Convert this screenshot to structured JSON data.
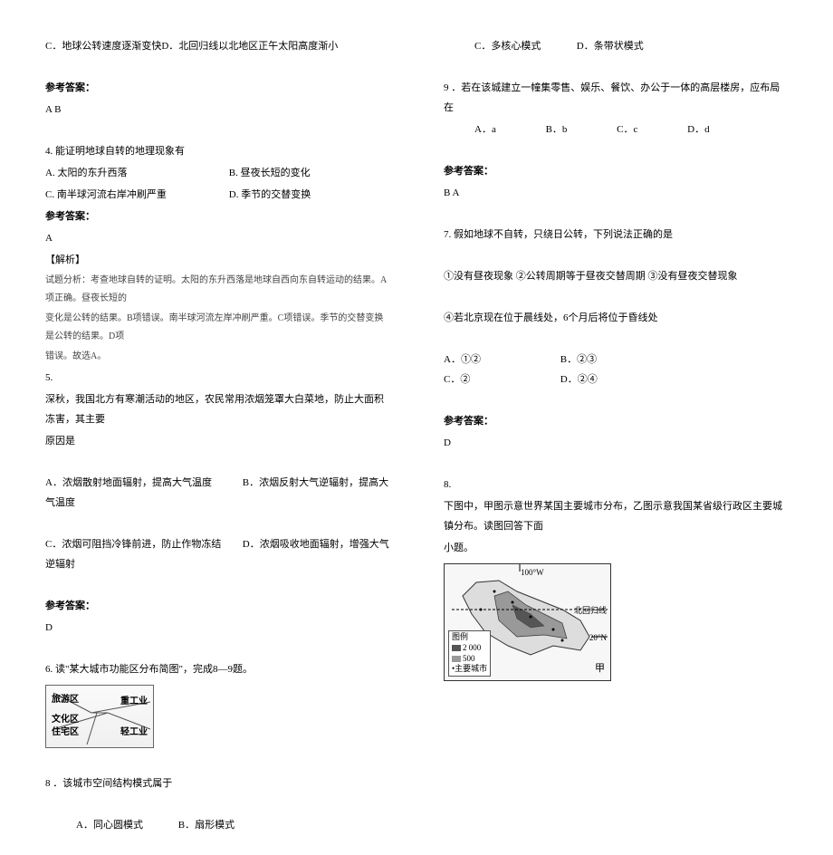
{
  "left": {
    "q3opt": "C．地球公转速度逐渐变快D．北回归线以北地区正午太阳高度渐小",
    "ansLabel1": "参考答案：",
    "ans1": "A  B",
    "q4": "4. 能证明地球自转的地理现象有",
    "q4a": "A. 太阳的东升西落",
    "q4b": "B. 昼夜长短的变化",
    "q4c": "C. 南半球河流右岸冲刷严重",
    "q4d": "D. 季节的交替变换",
    "ansLabel2": "参考答案：",
    "ans2": "A",
    "explLabel": "【解析】",
    "expl1": "试题分析：考查地球自转的证明。太阳的东升西落是地球自西向东自转运动的结果。A项正确。昼夜长短的",
    "expl2": "变化是公转的结果。B项错误。南半球河流左岸冲刷严重。C项错误。季节的交替变换是公转的结果。D项",
    "expl3": "错误。故选A。",
    "q5num": "5.",
    "q5a": "深秋，我国北方有寒潮活动的地区，农民常用浓烟笼罩大白菜地，防止大面积冻害，其主要",
    "q5b": "原因是",
    "q5optA": "A．浓烟散射地面辐射，提高大气温度",
    "q5optB": "B．浓烟反射大气逆辐射，提高大气温度",
    "q5optC": "C．浓烟可阻挡冷锋前进，防止作物冻结",
    "q5optD": "D．浓烟吸收地面辐射，增强大气逆辐射",
    "ansLabel3": "参考答案：",
    "ans3": "D",
    "q6": "6. 读\"某大城市功能区分布简图\"，完成8—9题。",
    "diag": {
      "tour": "旅游区",
      "heavy": "重工业",
      "culture": "文化区",
      "res": "住宅区",
      "light": "轻工业"
    },
    "q8a": "8 ．该城市空间结构模式属于",
    "q8optA": "A．同心圆模式",
    "q8optB": "B．扇形模式"
  },
  "right": {
    "q8optC": "C．多核心模式",
    "q8optD": "D．条带状模式",
    "q9": "9 ．若在该城建立一幢集零售、娱乐、餐饮、办公于一体的高层楼房，应布局在",
    "q9a": "A．a",
    "q9b": "B．b",
    "q9c": "C．c",
    "q9d": "D．d",
    "ansLabel4": "参考答案：",
    "ans4": "B  A",
    "q7": "7. 假如地球不自转，只绕日公转，下列说法正确的是",
    "q7l1": "①没有昼夜现象      ②公转周期等于昼夜交替周期      ③没有昼夜交替现象",
    "q7l2": "④若北京现在位于晨线处，6个月后将位于昏线处",
    "q7o": {
      "a": "A．①②",
      "b": "B．②③",
      "c": "C．②",
      "d": "D．②④"
    },
    "ansLabel5": "参考答案：",
    "ans5": "D",
    "q8h": "8.",
    "q8t1": "下图中，甲图示意世界某国主要城市分布，乙图示意我国某省级行政区主要城镇分布。读图回答下面",
    "q8t2": "小题。",
    "map": {
      "lon": "100°W",
      "tropic": "北回归线",
      "lat": "20°N",
      "legend": "图例",
      "l2000": "2 000",
      "l500": "500",
      "city": "主要城市",
      "name": "甲"
    }
  }
}
